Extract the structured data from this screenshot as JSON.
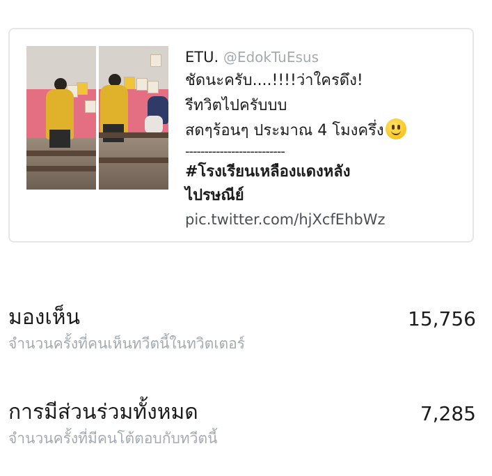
{
  "tweet": {
    "author_name": "ETU.",
    "author_handle": "@EdokTuEsus",
    "lines": [
      "ชัดนะครับ....!!!!ว่าใครดึง!",
      "รีทวิตไปครับบบ",
      "สดๆร้อนๆ ประมาณ 4 โมงครึ่ง"
    ],
    "emoji": "slightly-smiling-face",
    "divider": "--------------------------",
    "hashtag_line1": "#โรงเรียนเหลืองแดงหลัง",
    "hashtag_line2": "ไปรษณีย์",
    "pic_link": "pic.twitter.com/hjXcfEhbWz",
    "photo_count": 2
  },
  "stats": [
    {
      "title": "มองเห็น",
      "value": "15,756",
      "description": "จำนวนครั้งที่คนเห็นทวีตนี้ในทวิตเตอร์"
    },
    {
      "title": "การมีส่วนร่วมทั้งหมด",
      "value": "7,285",
      "description": "จำนวนครั้งที่มีคนโต้ตอบกับทวีตนี้"
    }
  ],
  "colors": {
    "card_border": "#e3e7ea",
    "muted_text": "#a4aab0",
    "primary_text": "#1c1c1c",
    "wall_pink": "#e56f82",
    "shirt_yellow": "#e0b22b"
  }
}
